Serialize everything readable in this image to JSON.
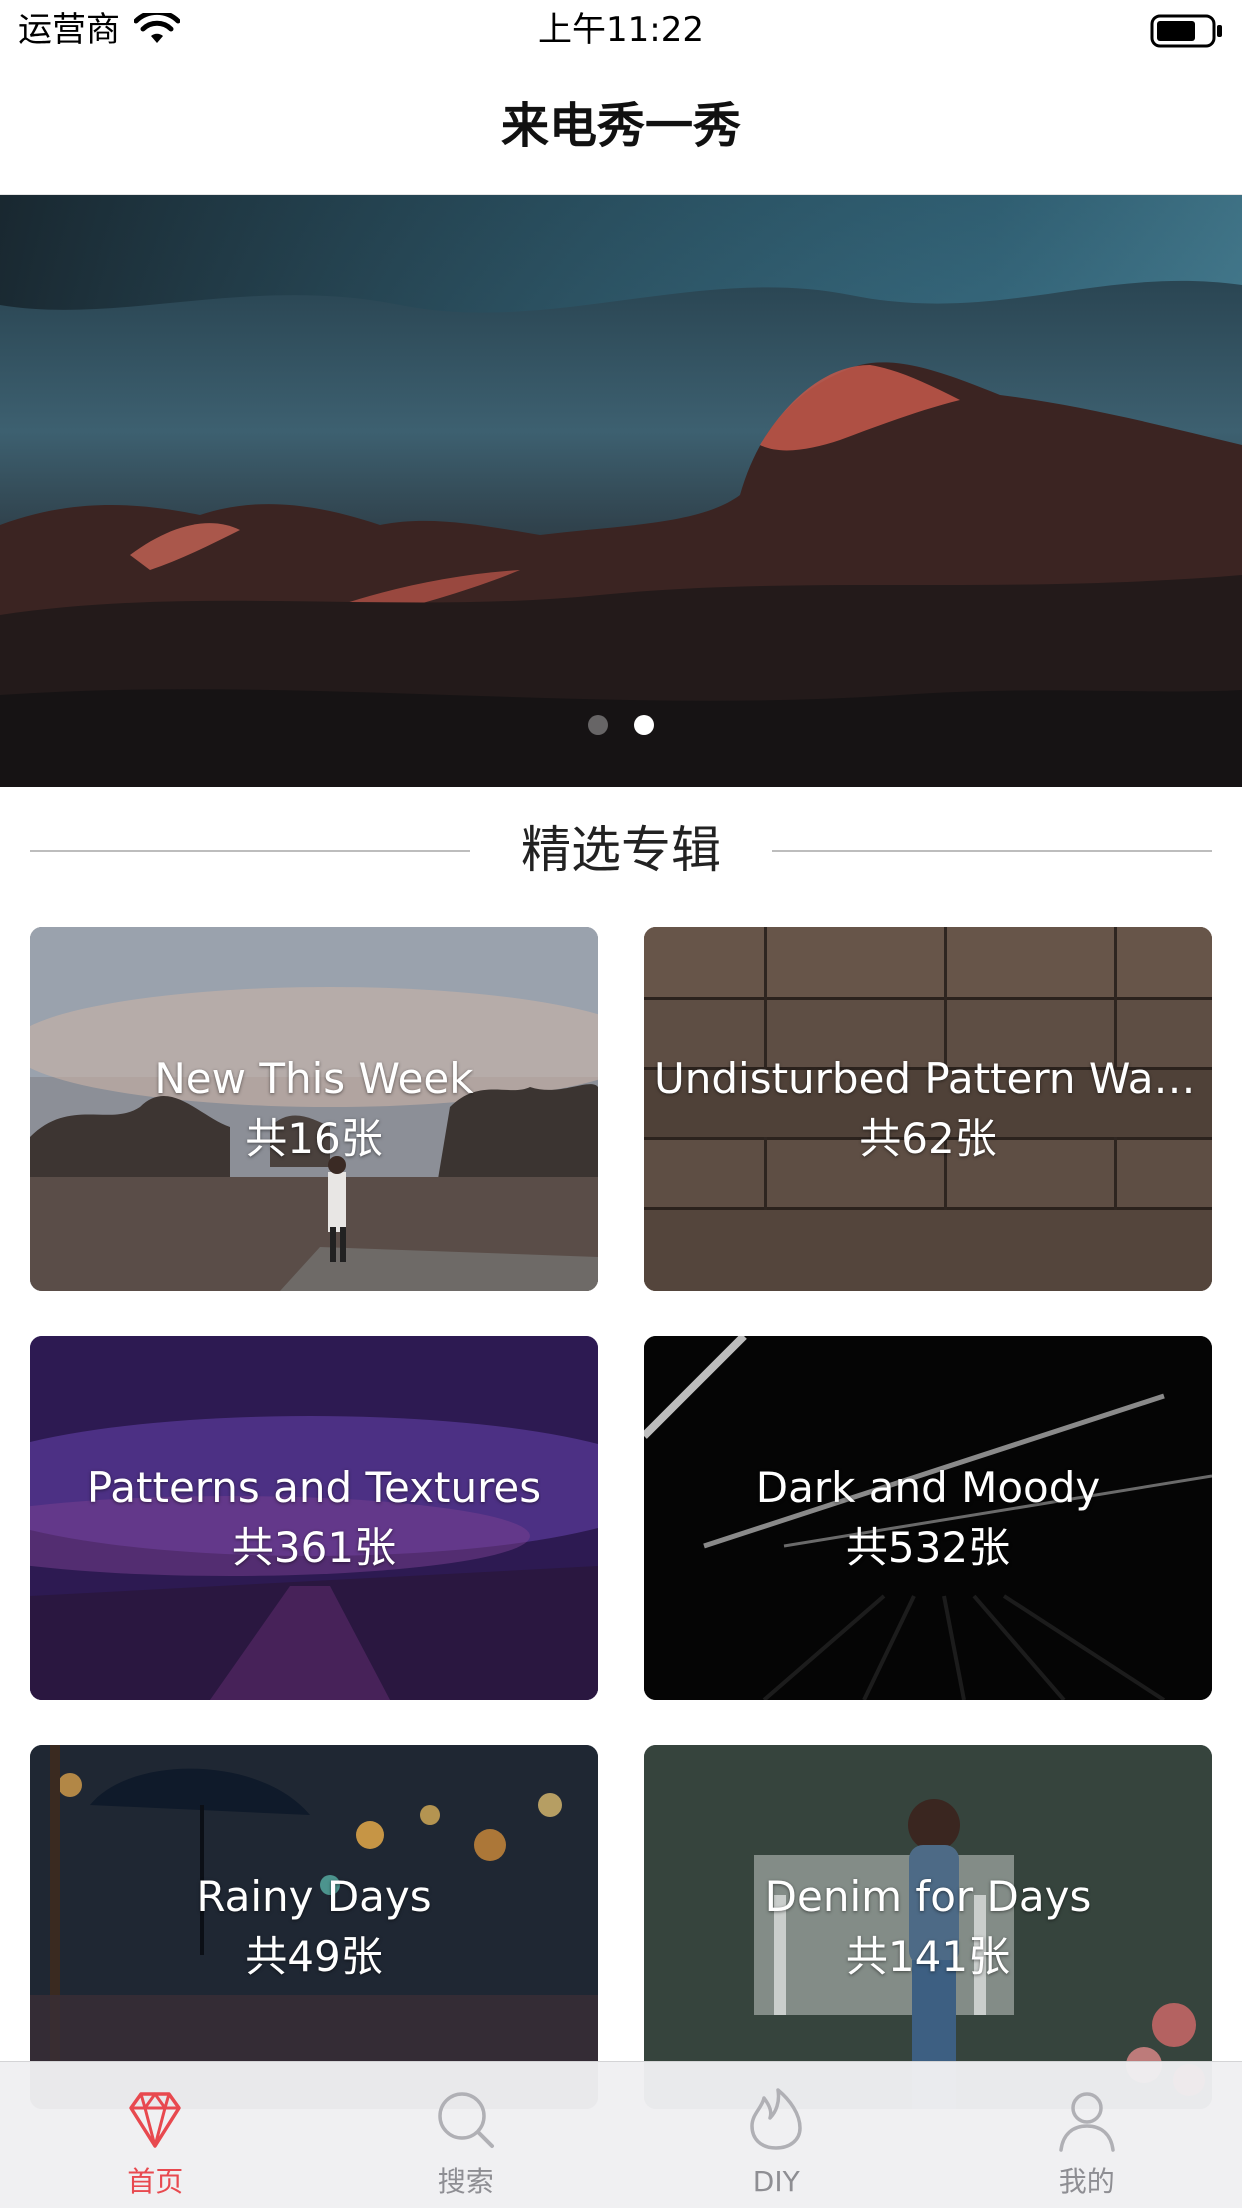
{
  "status_bar": {
    "carrier": "运营商",
    "time": "上午11:22"
  },
  "nav": {
    "title": "来电秀一秀"
  },
  "banner": {
    "page_count": 2,
    "active_page": 2
  },
  "section": {
    "title": "精选专辑"
  },
  "albums": [
    {
      "title": "New This Week",
      "count": "共16张"
    },
    {
      "title": "Undisturbed Pattern Wall...",
      "count": "共62张"
    },
    {
      "title": "Patterns and Textures",
      "count": "共361张"
    },
    {
      "title": "Dark and Moody",
      "count": "共532张"
    },
    {
      "title": "Rainy Days",
      "count": "共49张"
    },
    {
      "title": "Denim for Days",
      "count": "共141张"
    }
  ],
  "tab_bar": {
    "tabs": [
      {
        "label": "首页",
        "icon": "diamond-icon",
        "active": true
      },
      {
        "label": "搜索",
        "icon": "search-icon",
        "active": false
      },
      {
        "label": "DIY",
        "icon": "flame-icon",
        "active": false
      },
      {
        "label": "我的",
        "icon": "person-icon",
        "active": false
      }
    ],
    "active_color": "#e8494f",
    "inactive_color": "#8e8e93"
  }
}
